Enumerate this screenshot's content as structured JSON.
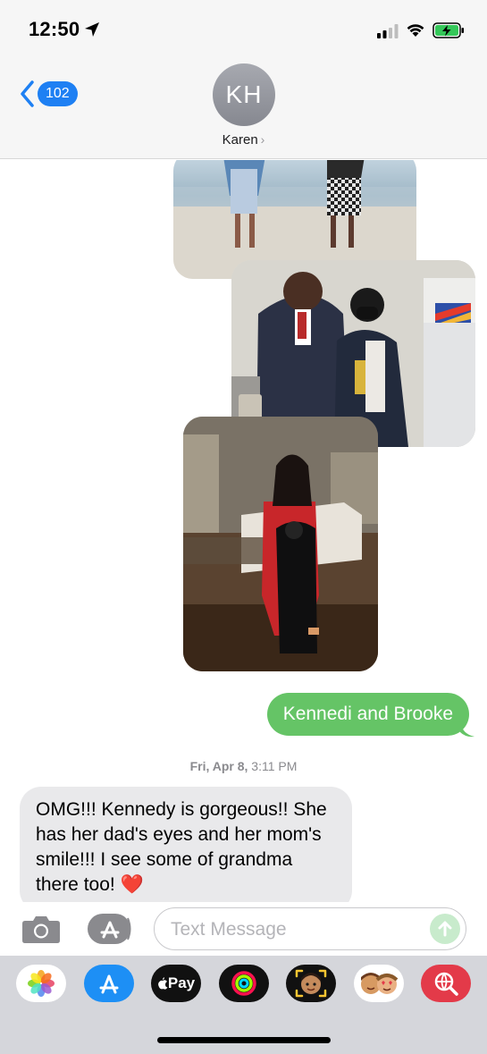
{
  "status_bar": {
    "time": "12:50",
    "icons": [
      "location-arrow-icon",
      "cellular-signal-icon",
      "wifi-icon",
      "battery-charging-icon"
    ]
  },
  "header": {
    "back_badge": "102",
    "avatar_initials": "KH",
    "contact_name": "Karen",
    "contact_chevron": "›"
  },
  "messages": {
    "photos": [
      "photo-beach",
      "photo-airport",
      "photo-house"
    ],
    "sent_text": "Kennedi and Brooke",
    "timestamp_day": "Fri, Apr 8,",
    "timestamp_time": "3:11 PM",
    "received_text": "OMG!!! Kennedy is gorgeous!! She has her dad's eyes and her mom's smile!!! I see some of grandma there too!",
    "received_emoji": "❤️"
  },
  "input_bar": {
    "placeholder": "Text Message",
    "value": ""
  },
  "app_drawer": {
    "apps": [
      "photos-icon",
      "app-store-icon",
      "apple-pay-icon",
      "activity-icon",
      "memoji-icon",
      "stickers-icon",
      "image-search-icon"
    ],
    "pay_label": "Pay"
  },
  "colors": {
    "sent_bubble": "#65c466",
    "received_bubble": "#e9e9eb",
    "accent_blue": "#1e80f3"
  }
}
